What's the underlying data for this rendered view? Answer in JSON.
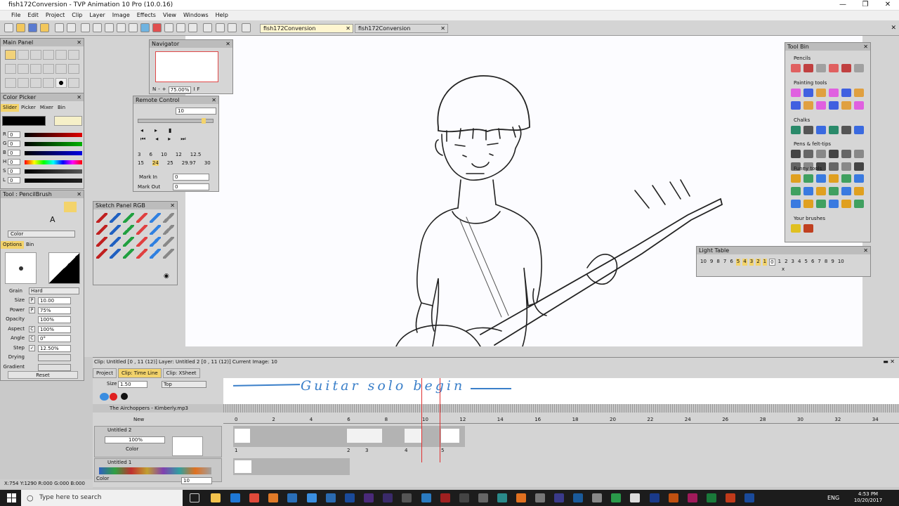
{
  "window": {
    "title": "fish172Conversion - TVP Animation 10 Pro (10.0.16)",
    "min": "—",
    "restore": "❐",
    "close": "✕"
  },
  "menu": [
    "File",
    "Edit",
    "Project",
    "Clip",
    "Layer",
    "Image",
    "Effects",
    "View",
    "Windows",
    "Help"
  ],
  "tabs": [
    {
      "label": "fish172Conversion"
    },
    {
      "label": "fish172Conversion"
    }
  ],
  "main_panel": {
    "title": "Main Panel"
  },
  "color_picker": {
    "title": "Color Picker",
    "tabs": [
      "Slider",
      "Picker",
      "Mixer",
      "Bin"
    ],
    "sliders": [
      {
        "ch": "R",
        "val": "0",
        "color": "#e00000"
      },
      {
        "ch": "G",
        "val": "0",
        "color": "#00b000"
      },
      {
        "ch": "B",
        "val": "0",
        "color": "#0000e0"
      },
      {
        "ch": "H",
        "val": "0",
        "color": "hue"
      },
      {
        "ch": "S",
        "val": "0",
        "color": "#555555"
      },
      {
        "ch": "L",
        "val": "0",
        "color": "#222222"
      }
    ]
  },
  "tool_panel": {
    "title": "Tool : PencilBrush",
    "color_label": "Color",
    "tabs": [
      "Options",
      "Bin"
    ],
    "grain_label": "Grain",
    "grain_val": "Hard",
    "props": [
      {
        "label": "Size",
        "flag": "P",
        "val": "10.00"
      },
      {
        "label": "Power",
        "flag": "P",
        "val": "75%"
      },
      {
        "label": "Opacity",
        "flag": "",
        "val": "100%"
      },
      {
        "label": "Aspect",
        "flag": "C",
        "val": "100%"
      },
      {
        "label": "Angle",
        "flag": "C",
        "val": "0°"
      },
      {
        "label": "Step",
        "flag": "✓",
        "val": "12.50%"
      },
      {
        "label": "Drying",
        "flag": "",
        "val": ""
      },
      {
        "label": "Gradient",
        "flag": "",
        "val": ""
      }
    ],
    "reset": "Reset"
  },
  "navigator": {
    "title": "Navigator",
    "zoom": "75.00%",
    "n": "N",
    "minus": "-",
    "plus": "+",
    "i": "I",
    "f": "F"
  },
  "remote": {
    "title": "Remote Control",
    "frame": "10",
    "fps_row1": [
      "3",
      "6",
      "10",
      "12",
      "12.5"
    ],
    "fps_row2": [
      "15",
      "24",
      "25",
      "29.97",
      "30"
    ],
    "mark_in_label": "Mark In",
    "mark_in": "0",
    "mark_out_label": "Mark Out",
    "mark_out": "0"
  },
  "sketch": {
    "title": "Sketch Panel RGB"
  },
  "tool_bin": {
    "title": "Tool Bin",
    "sections": [
      "Pencils",
      "Painting tools",
      "Chalks",
      "Pens & felt-tips",
      "Funny tools",
      "Your brushes"
    ]
  },
  "light_table": {
    "title": "Light Table",
    "left": [
      "10",
      "9",
      "8",
      "7",
      "6",
      "5",
      "4",
      "3",
      "2",
      "1"
    ],
    "center": "0",
    "right": [
      "1",
      "2",
      "3",
      "4",
      "5",
      "6",
      "7",
      "8",
      "9",
      "10"
    ],
    "x": "x"
  },
  "timeline": {
    "info": "Clip: Untitled [0 , 11 (12)]   Layer: Untitled 2 [0 , 11 (12)]   Current Image: 10",
    "tabs": [
      "Project",
      "Clip: Time Line",
      "Clip: XSheet"
    ],
    "size_label": "Size",
    "size_val": "1.50",
    "pos_val": "Top",
    "annotation": "Guitar solo begin",
    "sound_track": "The Airchoppers - Kimberly.mp3",
    "new_label": "New",
    "ruler": [
      "0",
      "2",
      "4",
      "6",
      "8",
      "10",
      "12",
      "14",
      "16",
      "18",
      "20",
      "22",
      "24",
      "26",
      "28",
      "30",
      "32",
      "34"
    ],
    "layer2": {
      "name": "Untitled 2",
      "opacity": "100%",
      "color": "Color"
    },
    "layer1": {
      "name": "Untitled 1"
    },
    "frame_nums": [
      "1",
      "2",
      "3",
      "4",
      "5"
    ],
    "color_label": "Color",
    "bottom_val": "10"
  },
  "status": "X:754  Y:1290  R:000 G:000 B:000",
  "taskbar": {
    "search": "Type here to search",
    "lang": "ENG",
    "time": "4:53 PM",
    "date": "10/20/2017"
  }
}
